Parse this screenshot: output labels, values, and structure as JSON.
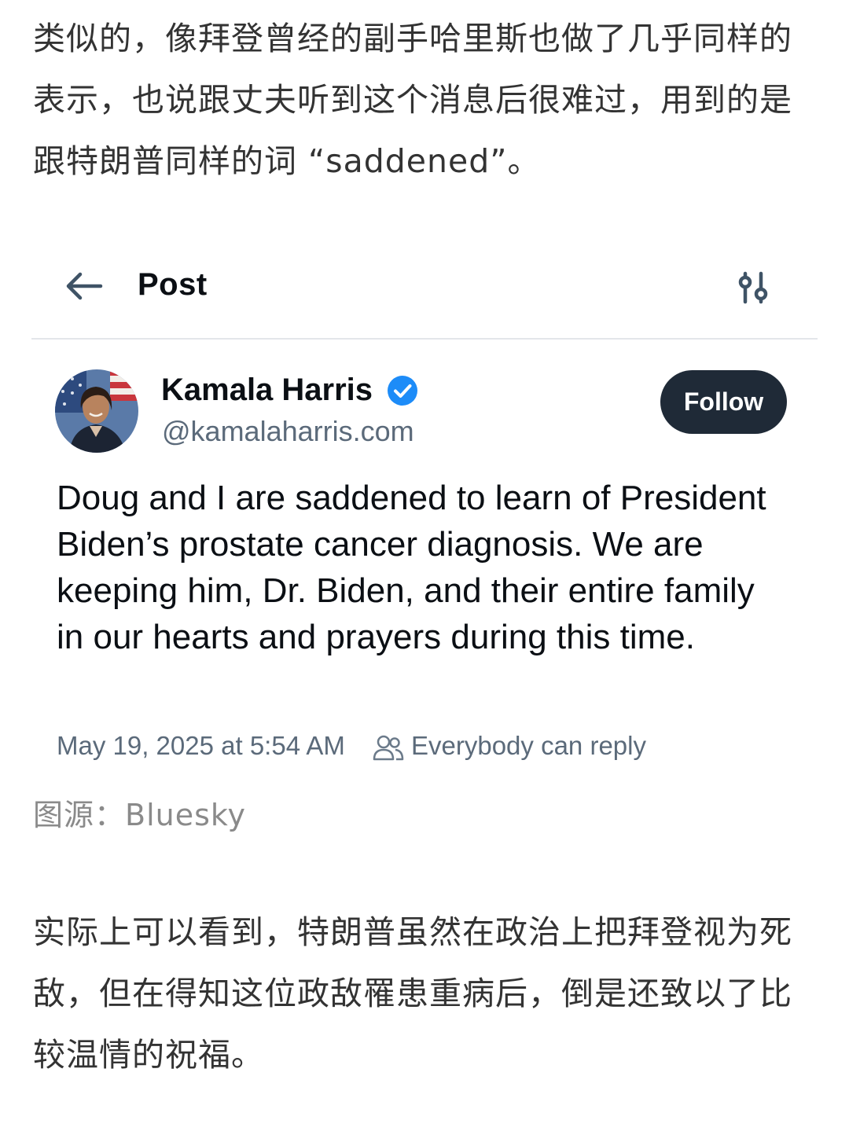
{
  "article": {
    "intro_paragraph": "类似的，像拜登曾经的副手哈里斯也做了几乎同样的表示，也说跟丈夫听到这个消息后很难过，用到的是跟特朗普同样的词 “saddened”。",
    "image_caption": "图源：Bluesky",
    "closing_paragraph": "实际上可以看到，特朗普虽然在政治上把拜登视为死敌，但在得知这位政敌罹患重病后，倒是还致以了比较温情的祝福。"
  },
  "post_screenshot": {
    "header": {
      "title": "Post",
      "back_icon": "arrow-left-icon",
      "options_icon": "sliders-icon"
    },
    "author": {
      "name": "Kamala Harris",
      "handle": "@kamalaharris.com",
      "verified": true,
      "verified_color": "#1d8cf8"
    },
    "follow_label": "Follow",
    "body": "Doug and I are saddened to learn of President Biden’s prostate cancer diagnosis. We are keeping him, Dr. Biden, and their entire family in our hearts and prayers during this time.",
    "timestamp": "May 19, 2025 at 5:54 AM",
    "reply_setting": "Everybody can reply",
    "reply_icon": "people-icon"
  }
}
